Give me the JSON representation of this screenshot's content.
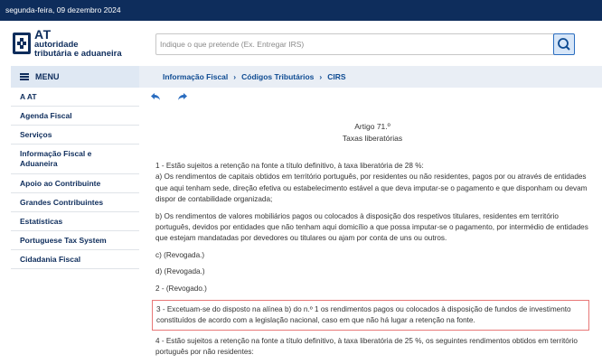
{
  "topbar": {
    "date": "segunda-feira, 09 dezembro 2024"
  },
  "logo": {
    "short": "AT",
    "line1": "autoridade",
    "line2": "tributária e aduaneira"
  },
  "search": {
    "placeholder": "Indique o que pretende (Ex. Entregar IRS)"
  },
  "sidebar": {
    "menu_label": "MENU",
    "items": [
      {
        "label": "A AT"
      },
      {
        "label": "Agenda Fiscal"
      },
      {
        "label": "Serviços"
      },
      {
        "label": "Informação Fiscal e Aduaneira"
      },
      {
        "label": "Apoio ao Contribuinte"
      },
      {
        "label": "Grandes Contribuintes"
      },
      {
        "label": "Estatísticas"
      },
      {
        "label": "Portuguese Tax System"
      },
      {
        "label": "Cidadania Fiscal"
      }
    ]
  },
  "breadcrumb": [
    "Informação Fiscal",
    "Códigos Tributários",
    "CIRS"
  ],
  "article": {
    "title": "Artigo 71.º",
    "subtitle": "Taxas liberatórias",
    "paragraphs": [
      "1 - Estão sujeitos a retenção na fonte a título definitivo, à taxa liberatória de 28 %:",
      "a) Os rendimentos de capitais obtidos em território português, por residentes ou não residentes, pagos por ou através de entidades que aqui tenham sede, direção efetiva ou estabelecimento estável a que deva imputar-se o pagamento e que disponham ou devam dispor de contabilidade organizada;",
      "b) Os rendimentos de valores mobiliários pagos ou colocados à disposição dos respetivos titulares, residentes em território português, devidos por entidades que não tenham aqui domicílio a que possa imputar-se o pagamento, por intermédio de entidades que estejam mandatadas por devedores ou titulares ou ajam por conta de uns ou outros.",
      "c) (Revogada.)",
      "d) (Revogada.)",
      "2 - (Revogado.)"
    ],
    "highlighted": "3 - Excetuam-se do disposto na alínea b) do n.º 1 os rendimentos pagos ou colocados à disposição de fundos de investimento constituídos de acordo com a legislação nacional, caso em que não há lugar a retenção na fonte.",
    "after": "4 - Estão sujeitos a retenção na fonte a título definitivo, à taxa liberatória de 25 %, os seguintes rendimentos obtidos em território português por não residentes:"
  },
  "colors": {
    "navy": "#0e2d5c",
    "link": "#0e4b92",
    "highlight_border": "#e87878",
    "search_btn": "#2a6dc0"
  },
  "icons": {
    "search": "search-icon",
    "back": "back-arrow-icon",
    "forward": "forward-arrow-icon",
    "menu": "hamburger-icon"
  }
}
